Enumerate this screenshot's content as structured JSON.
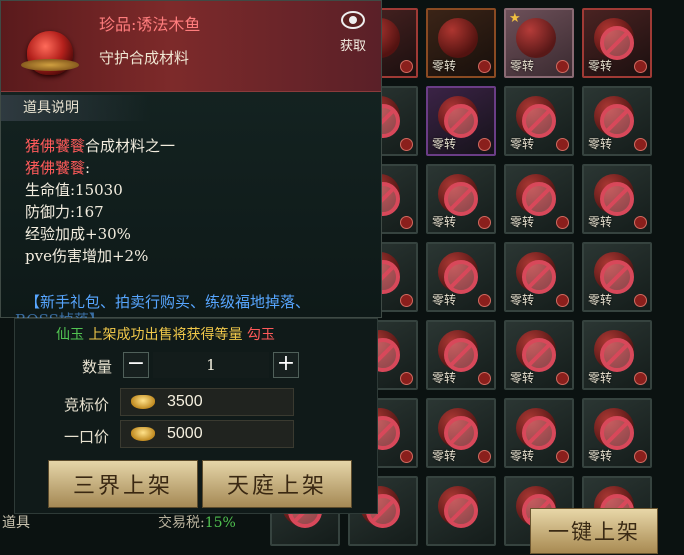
{
  "tooltip": {
    "item_name": "珍品:诱法木鱼",
    "item_subtitle": "守护合成材料",
    "get_label": "获取",
    "desc_title": "道具说明",
    "desc_line1_red": "猪佛饕餮",
    "desc_line1_rest": "合成材料之一",
    "desc_line2_red": "猪佛饕餮",
    "desc_line2_rest": ":",
    "stat_hp": "生命值:15030",
    "stat_def": "防御力:167",
    "stat_exp": "经验加成+30%",
    "stat_pve": "pve伤害增加+2%",
    "source": "【新手礼包、拍卖行购买、练级福地掉落、",
    "source2": "BOSS掉落】"
  },
  "sell": {
    "notice_green": "仙玉",
    "notice_mid": " 上架成功出售将获得等量 ",
    "notice_red": "勾玉",
    "qty_label": "数量",
    "qty_minus": "−",
    "qty_value": "1",
    "qty_plus": "+",
    "bid_label": "竞标价",
    "bid_value": "3500",
    "buyout_label": "一口价",
    "buyout_value": "5000",
    "btn_three_realms": "三界上架",
    "btn_heaven": "天庭上架"
  },
  "footer": {
    "left_label": "道具",
    "tax_label": "交易税:",
    "tax_value": "15%",
    "one_click": "一键上架"
  },
  "grid": {
    "slot_tag": "零转"
  },
  "colors": {
    "name_red": "#ff7d7d",
    "source_blue": "#57a6ff",
    "notice_gold": "#f0c84a",
    "tax_green": "#4fbf4f"
  }
}
